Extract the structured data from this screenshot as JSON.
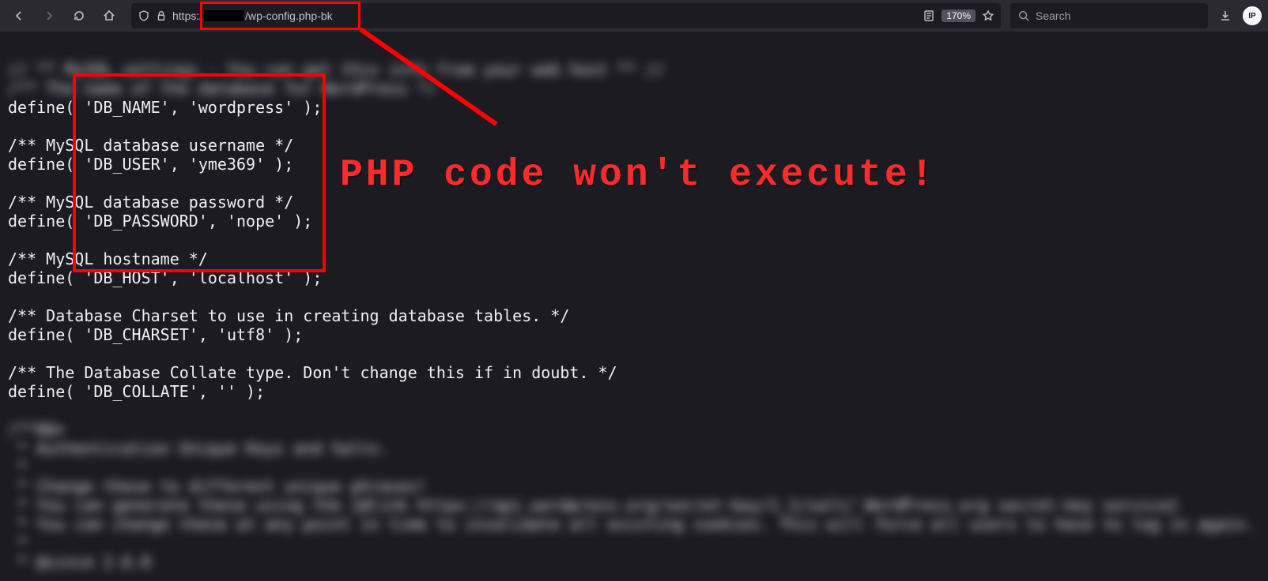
{
  "toolbar": {
    "url_prefix": "https:/",
    "url_path": "/wp-config.php-bk",
    "zoom": "170%",
    "search_placeholder": "Search"
  },
  "code": {
    "blurred_top1": "// ** MySQL settings - You can get this info from your web host ** //",
    "blurred_top2": "/** The name of the database for WordPress */",
    "line1": "define( 'DB_NAME', 'wordpress' );",
    "line2": "",
    "line3": "/** MySQL database username */",
    "line4": "define( 'DB_USER', 'yme369' );",
    "line5": "",
    "line6": "/** MySQL database password */",
    "line7": "define( 'DB_PASSWORD', 'nope' );",
    "line8": "",
    "line9": "/** MySQL hostname */",
    "line10": "define( 'DB_HOST', 'localhost' );",
    "line11": "",
    "line12": "/** Database Charset to use in creating database tables. */",
    "line13": "define( 'DB_CHARSET', 'utf8' );",
    "line14": "",
    "line15": "/** The Database Collate type. Don't change this if in doubt. */",
    "line16": "define( 'DB_COLLATE', '' );",
    "blurred_b1": "/**#@+",
    "blurred_b2": " * Authentication Unique Keys and Salts.",
    "blurred_b3": " *",
    "blurred_b4": " * Change these to different unique phrases!",
    "blurred_b5": " * You can generate these using the {@link https://api.wordpress.org/secret-key/1.1/salt/ WordPress.org secret-key service}",
    "blurred_b6": " * You can change these at any point in time to invalidate all existing cookies. This will force all users to have to log in again.",
    "blurred_b7": " *",
    "blurred_b8": " * @since 2.6.0"
  },
  "annotation": {
    "text": "PHP code won't execute!"
  },
  "ip_badge": "IP"
}
